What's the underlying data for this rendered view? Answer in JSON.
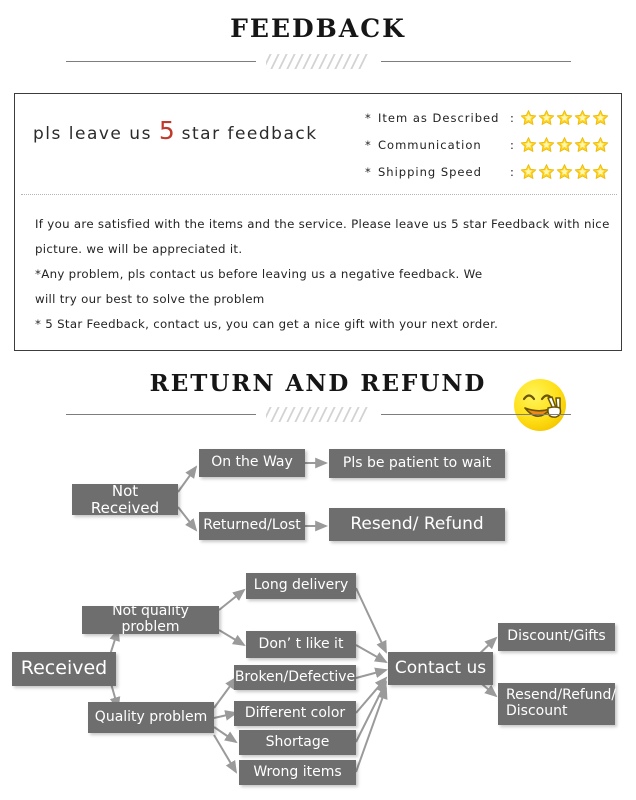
{
  "sections": {
    "feedback": {
      "title": "FEEDBACK",
      "headline_before": "pls leave us ",
      "headline_number": "5",
      "headline_after": " star feedback",
      "ratings": [
        {
          "bullet": "*",
          "label": "Item as Described",
          "colon": ":",
          "stars": 5
        },
        {
          "bullet": "*",
          "label": "Communication",
          "colon": ":",
          "stars": 5
        },
        {
          "bullet": "*",
          "label": "Shipping Speed",
          "colon": ":",
          "stars": 5
        }
      ],
      "body": [
        "If you are satisfied with the items and the service. Please leave us 5 star Feedback with nice",
        "picture. we will be appreciated it.",
        "*Any problem, pls contact us before leaving us a negative feedback. We",
        "will try our best to solve  the problem",
        "* 5 Star Feedback, contact us, you can get a nice gift with your next order."
      ],
      "emoji": "smiling-face-with-peace-hand"
    },
    "return": {
      "title": "RETURN AND REFUND"
    }
  },
  "flowchart": {
    "nodes": {
      "not_received": "Not Received",
      "on_the_way": "On the Way",
      "returned_lost": "Returned/Lost",
      "pls_wait": "Pls be patient to wait",
      "resend_refund": "Resend/ Refund",
      "received": "Received",
      "not_quality_problem": "Not quality problem",
      "quality_problem": "Quality problem",
      "long_delivery": "Long delivery",
      "dont_like_it": "Don’ t like it",
      "broken_defective": "Broken/Defective",
      "different_color": "Different color",
      "shortage": "Shortage",
      "wrong_items": "Wrong items",
      "contact_us": "Contact us",
      "discount_gifts": "Discount/Gifts",
      "resend_refund_discount": "Resend/Refund/\nDiscount"
    }
  },
  "colors": {
    "node_fill": "#6e6e6e",
    "node_text": "#ffffff",
    "arrow": "#9a9a9a",
    "star": "#ffd21e",
    "accent_red": "#c0392b",
    "rule": "#7d7d7d",
    "hatch": "#d3d3d3"
  }
}
